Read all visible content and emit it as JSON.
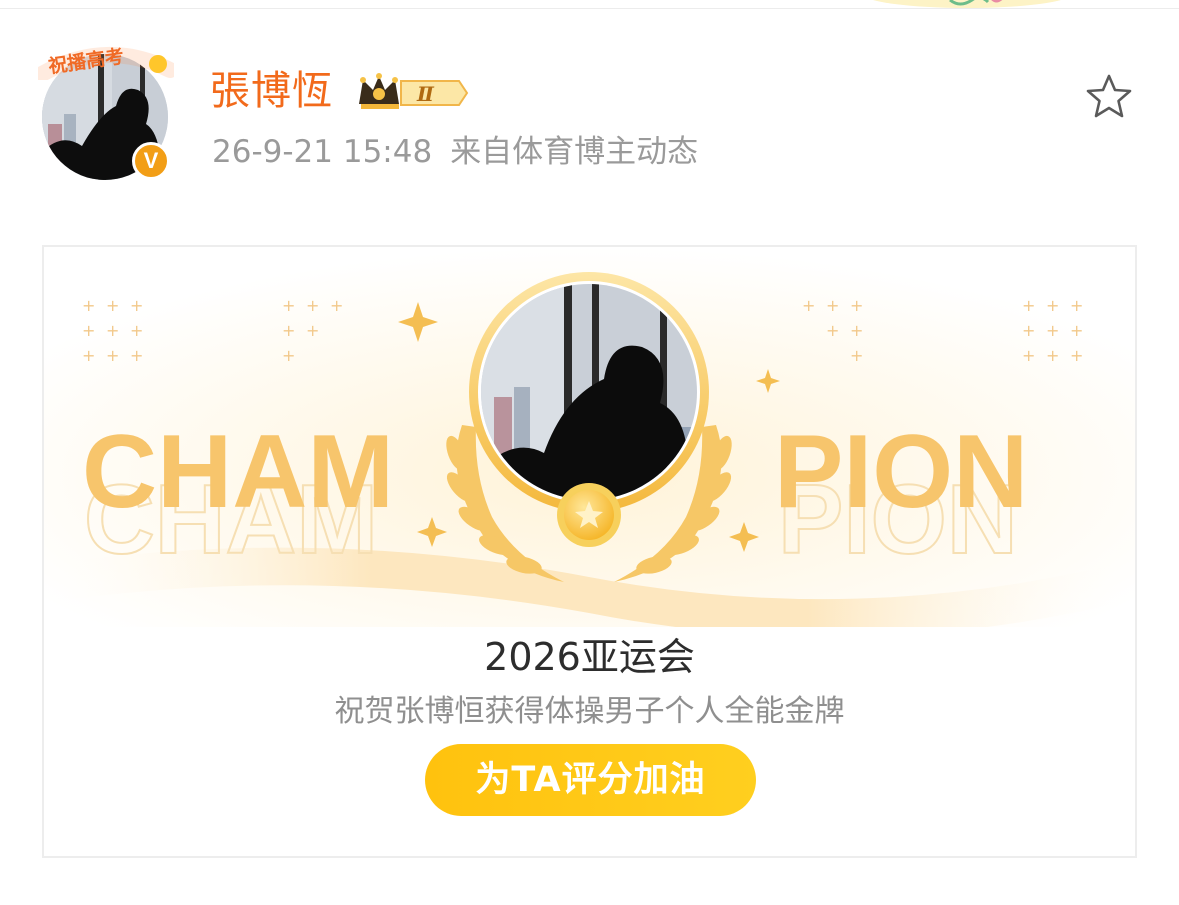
{
  "post": {
    "author": "張博恆",
    "vip_level": "Ⅱ",
    "avatar_badge": "祝播高考",
    "verified_mark": "V",
    "timestamp": "26-9-21 15:48",
    "source": "来自体育博主动态"
  },
  "card": {
    "banner_left": "CHAM",
    "banner_right": "PION",
    "event_title": "2026亚运会",
    "event_desc": "祝贺张博恒获得体操男子个人全能金牌",
    "cta_label": "为TA评分加油"
  },
  "icons": {
    "favorite": "star-outline-icon",
    "vip": "crown-icon",
    "verified": "verified-v-icon"
  },
  "colors": {
    "username": "#f26a1b",
    "gold": "#f5c46c",
    "cta": "#ffc20e",
    "verified": "#f29e16"
  }
}
